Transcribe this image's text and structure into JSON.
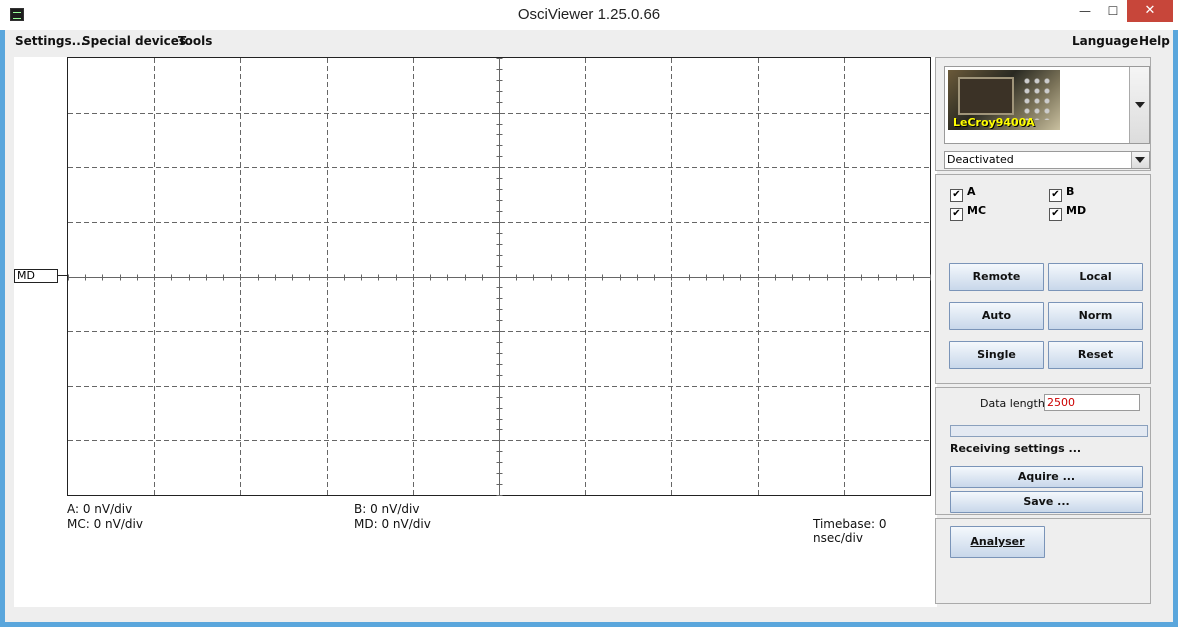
{
  "window": {
    "title": "OsciViewer 1.25.0.66",
    "minimize": "—",
    "maximize": "☐",
    "close": "✕"
  },
  "menu": {
    "settings": "Settings...",
    "special_devices": "Special devices",
    "tools": "Tools",
    "language": "Language",
    "help": "Help"
  },
  "scope": {
    "channel_marker": "MD",
    "channel_labels": {
      "a": "A:  0 nV/div",
      "b": "B:  0 nV/div",
      "mc": "MC:  0 nV/div",
      "md": "MD:  0 nV/div"
    },
    "timebase": "Timebase: 0 nsec/div"
  },
  "device": {
    "name": "LeCroy9400A",
    "status_selected": "Deactivated"
  },
  "channels": [
    {
      "label": "A",
      "checked": true
    },
    {
      "label": "B",
      "checked": true
    },
    {
      "label": "MC",
      "checked": true
    },
    {
      "label": "MD",
      "checked": true
    }
  ],
  "buttons": {
    "remote": "Remote",
    "local": "Local",
    "auto": "Auto",
    "norm": "Norm",
    "single": "Single",
    "reset": "Reset",
    "aquire": "Aquire ...",
    "save": "Save ...",
    "analyser": "Analyser"
  },
  "acquisition": {
    "data_length_label": "Data length:",
    "data_length_value": "2500",
    "status": "Receiving settings ...",
    "progress": 0
  }
}
